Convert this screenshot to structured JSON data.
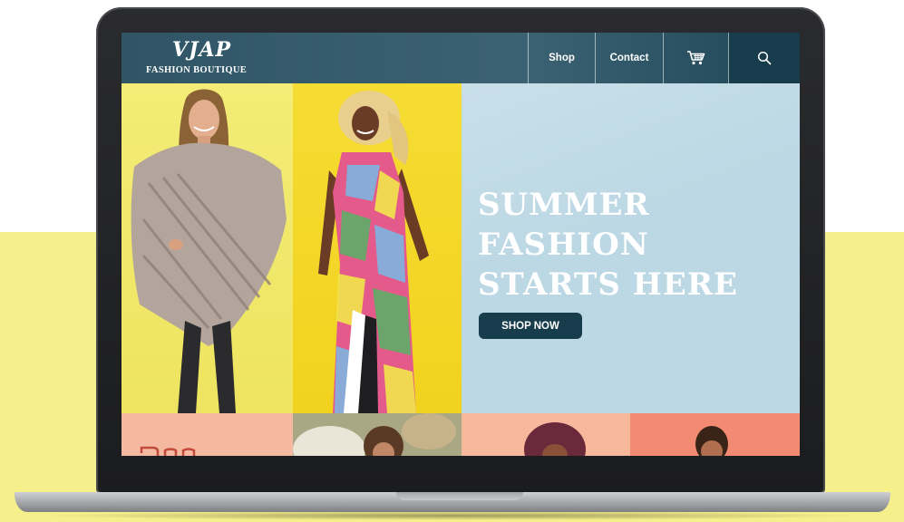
{
  "brand": {
    "logo_mark": "VJAP",
    "logo_subtitle": "FASHION BOUTIQUE"
  },
  "nav": {
    "items": [
      "Shop",
      "Contact"
    ],
    "cart_icon": "cart-icon",
    "search_icon": "search-icon"
  },
  "hero": {
    "headline_lines": [
      "SUMMER",
      "FASHION",
      "STARTS HERE"
    ],
    "cta_label": "SHOP NOW"
  },
  "colors": {
    "nav": "#2f5566",
    "accent_dark": "#173c4b",
    "panel_yellow_light": "#f3ec76",
    "panel_yellow": "#f6dc33",
    "panel_blue": "#bcd8e4",
    "background_band": "#f5ef8c"
  }
}
